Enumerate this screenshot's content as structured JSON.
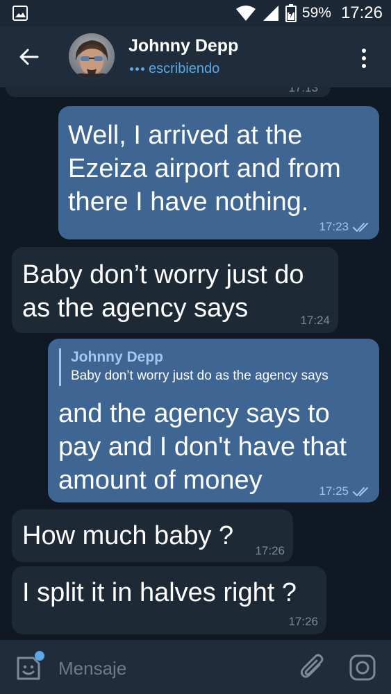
{
  "status_bar": {
    "battery_percent": "59%",
    "time": "17:26",
    "icons": [
      "gallery-icon",
      "wifi-icon",
      "signal-icon",
      "battery-icon"
    ]
  },
  "header": {
    "contact_name": "Johnny Depp",
    "status": "escribiendo",
    "back_icon": "arrow-left-icon",
    "menu_icon": "more-vertical-icon"
  },
  "chat": {
    "date_chip": "17:13",
    "messages": [
      {
        "direction": "out",
        "text": "Well, I arrived at the\nEzeiza airport and from\nthere I have nothing.",
        "time": "17:23",
        "read": true
      },
      {
        "direction": "in",
        "text": "Baby don’t worry just do\nas the agency says",
        "time": "17:24"
      },
      {
        "direction": "out",
        "reply_to": {
          "name": "Johnny Depp",
          "text": "Baby don’t worry just do as the agency says"
        },
        "text": "and the agency says to\npay and I don't have that\namount of money",
        "time": "17:25",
        "read": true
      },
      {
        "direction": "in",
        "text": "How much baby ?",
        "time": "17:26"
      },
      {
        "direction": "in",
        "text": "I split it in halves right ?",
        "time": "17:26"
      }
    ]
  },
  "input_bar": {
    "placeholder": "Mensaje",
    "value": "",
    "icons": [
      "sticker-icon",
      "paperclip-icon",
      "camera-icon"
    ]
  },
  "colors": {
    "background": "#0f1823",
    "header": "#1f2c3c",
    "incoming_bubble": "#1e2936",
    "outgoing_bubble": "#3f6593",
    "accent": "#5aa9e8"
  }
}
